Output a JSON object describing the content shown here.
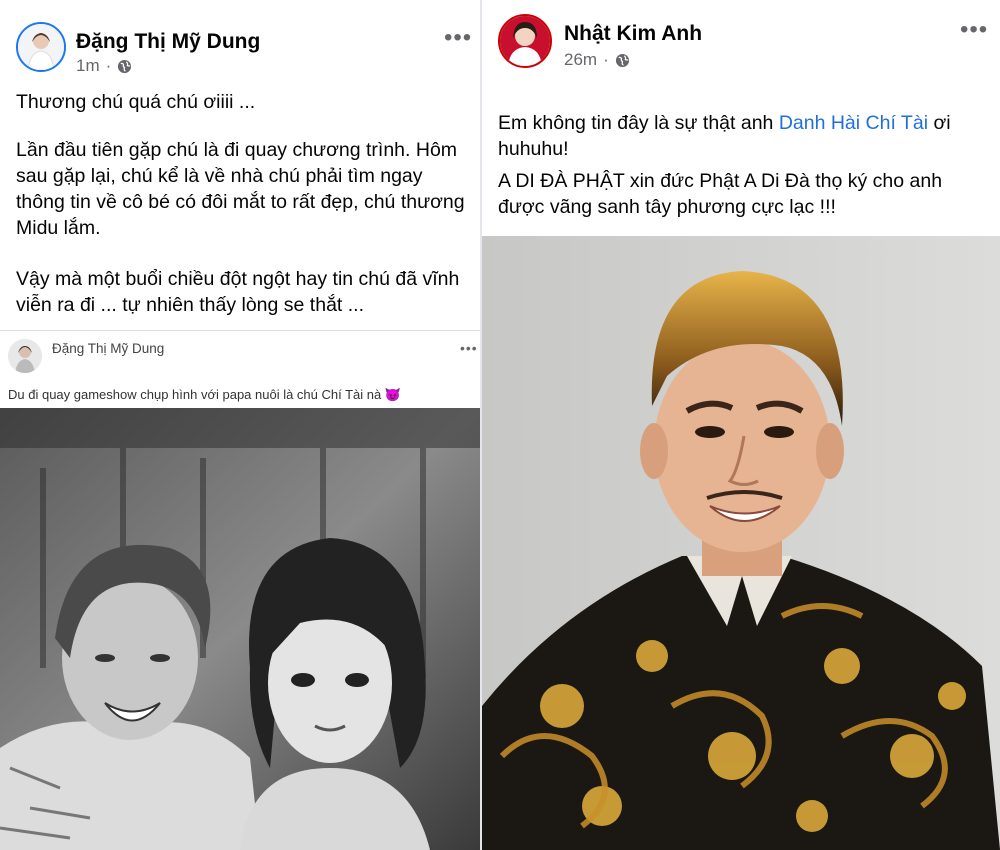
{
  "left_post": {
    "author": "Đặng Thị Mỹ Dung",
    "time": "1m",
    "more": "•••",
    "paragraphs": [
      "Thương chú quá chú ơiiii ...",
      "Lần đầu tiên gặp chú là đi quay chương trình. Hôm sau gặp lại, chú kể là về nhà chú phải tìm ngay thông tin về cô bé có đôi mắt to rất đẹp, chú thương Midu lắm.",
      "Vậy mà một buổi chiều đột ngột hay tin chú đã vĩnh viễn ra đi ... tự nhiên thấy lòng se thắt ..."
    ],
    "shared": {
      "author": "Đặng Thị Mỹ Dung",
      "more": "•••",
      "caption": "Du đi quay gameshow chụp hình với papa nuôi là chú Chí Tài nà 😈"
    }
  },
  "right_post": {
    "author": "Nhật Kim Anh",
    "time": "26m",
    "more": "•••",
    "text_before_link": "Em không tin đây là sự thật anh ",
    "link_text": "Danh Hài Chí Tài",
    "text_after_link": " ơi huhuhu!",
    "paragraph2": "A DI ĐÀ PHẬT xin đức Phật A Di Đà thọ ký cho anh được vãng sanh tây phương cực lạc !!!"
  },
  "colors": {
    "link": "#216fdb",
    "meta": "#65676b"
  }
}
